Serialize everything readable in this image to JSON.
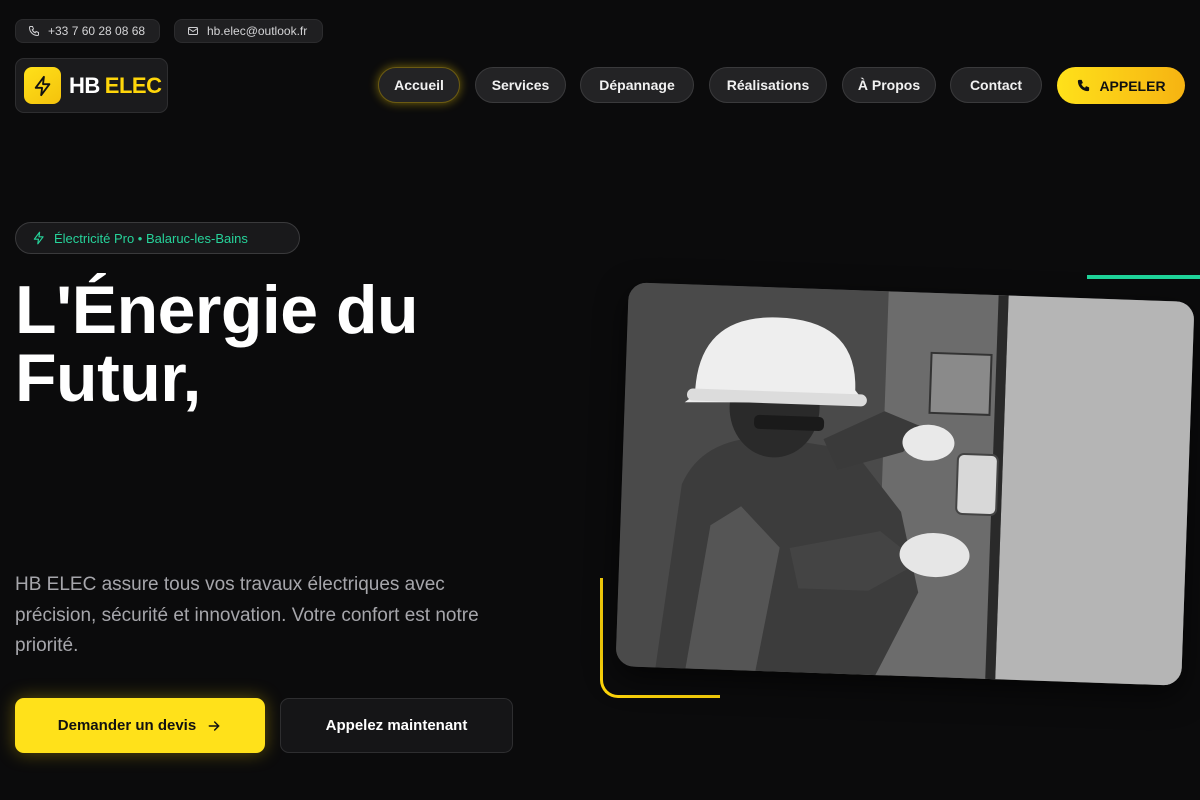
{
  "topbar": {
    "phone": "+33 7 60 28 08 68",
    "email": "hb.elec@outlook.fr"
  },
  "logo": {
    "part1": "HB",
    "part2": "ELEC",
    "icon": "lightning-bolt-icon"
  },
  "nav": {
    "items": [
      "Accueil",
      "Services",
      "Dépannage",
      "Réalisations",
      "À Propos",
      "Contact"
    ],
    "active": "Accueil",
    "cta_label": "APPELER"
  },
  "hero": {
    "badge": "Électricité Pro • Balaruc-les-Bains",
    "title_line1": "L'Énergie du",
    "title_line2": "Futur,",
    "description": "HB ELEC assure tous vos travaux électriques avec précision, sécurité et innovation. Votre confort est notre priorité.",
    "primary_button": "Demander un devis",
    "secondary_button": "Appelez maintenant"
  },
  "colors": {
    "accent_yellow": "#ffd60a",
    "accent_green": "#1fd49a",
    "background": "#0b0b0c"
  }
}
